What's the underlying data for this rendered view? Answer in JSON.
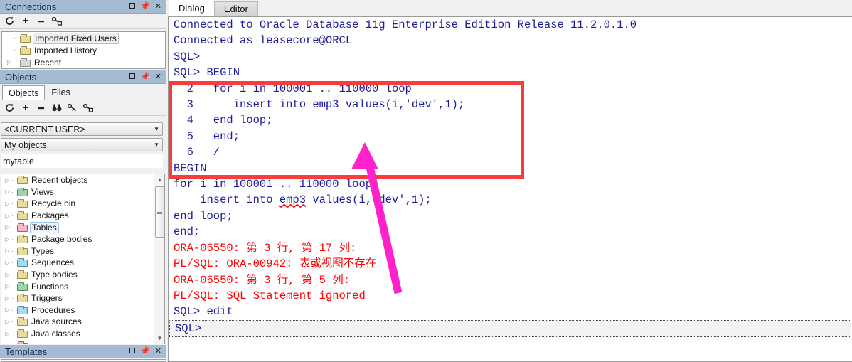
{
  "connections_panel": {
    "title": "Connections",
    "window_buttons": [
      "maximize",
      "pin",
      "close"
    ],
    "toolbar_icons": [
      "refresh-icon",
      "plus-icon",
      "minus-icon",
      "key-lock-icon"
    ],
    "tree": [
      {
        "label": "Imported Fixed Users",
        "icon": "folder-icon",
        "color": "yellow",
        "expander": false,
        "selected": true
      },
      {
        "label": "Imported History",
        "icon": "folder-icon",
        "color": "yellow",
        "expander": false,
        "selected": false
      },
      {
        "label": "Recent",
        "icon": "folder-icon",
        "color": "gray",
        "expander": true,
        "selected": false
      }
    ]
  },
  "objects_panel": {
    "title": "Objects",
    "window_buttons": [
      "maximize",
      "pin",
      "close"
    ],
    "tabs": [
      {
        "label": "Objects",
        "active": true
      },
      {
        "label": "Files",
        "active": false
      }
    ],
    "toolbar_icons": [
      "refresh-icon",
      "plus-icon",
      "minus-icon",
      "binoculars-icon",
      "key-icon",
      "key-lock-icon"
    ],
    "user_select": {
      "value": "<CURRENT USER>"
    },
    "scope_select": {
      "value": "My objects"
    },
    "filter_field": {
      "value": "mytable",
      "placeholder": ""
    },
    "tree": [
      {
        "label": "Recent objects",
        "color": "yellow",
        "selected": false
      },
      {
        "label": "Views",
        "color": "green",
        "selected": false
      },
      {
        "label": "Recycle bin",
        "color": "yellow",
        "selected": false
      },
      {
        "label": "Packages",
        "color": "yellow",
        "selected": false
      },
      {
        "label": "Tables",
        "color": "pink",
        "selected": true
      },
      {
        "label": "Package bodies",
        "color": "yellow",
        "selected": false
      },
      {
        "label": "Types",
        "color": "yellow",
        "selected": false
      },
      {
        "label": "Sequences",
        "color": "cyan",
        "selected": false
      },
      {
        "label": "Type bodies",
        "color": "yellow",
        "selected": false
      },
      {
        "label": "Functions",
        "color": "green",
        "selected": false
      },
      {
        "label": "Triggers",
        "color": "yellow",
        "selected": false
      },
      {
        "label": "Procedures",
        "color": "cyan",
        "selected": false
      },
      {
        "label": "Java sources",
        "color": "yellow",
        "selected": false
      },
      {
        "label": "Java classes",
        "color": "yellow",
        "selected": false
      },
      {
        "label": "..",
        "color": "pink",
        "selected": false
      }
    ]
  },
  "templates_panel": {
    "title": "Templates",
    "window_buttons": [
      "maximize",
      "pin",
      "close"
    ]
  },
  "main": {
    "tabs": [
      {
        "label": "Dialog",
        "active": true
      },
      {
        "label": "Editor",
        "active": false
      }
    ],
    "console_lines": [
      {
        "text": "Connected to Oracle Database 11g Enterprise Edition Release 11.2.0.1.0",
        "kind": "normal"
      },
      {
        "text": "Connected as leasecore@ORCL",
        "kind": "normal"
      },
      {
        "text": "",
        "kind": "blank"
      },
      {
        "text": "SQL>",
        "kind": "normal"
      },
      {
        "text": "SQL> BEGIN",
        "kind": "normal"
      },
      {
        "text": "  2   for i in 100001 .. 110000 loop",
        "kind": "normal"
      },
      {
        "text": "  3      insert into emp3 values(i,'dev',1);",
        "kind": "normal"
      },
      {
        "text": "  4   end loop;",
        "kind": "normal"
      },
      {
        "text": "  5   end;",
        "kind": "normal"
      },
      {
        "text": "  6   /",
        "kind": "normal"
      },
      {
        "text": "BEGIN",
        "kind": "normal"
      },
      {
        "text": "for i in 100001 .. 110000 loop",
        "kind": "normal"
      },
      {
        "text": "    insert into emp3 values(i,'dev',1);",
        "kind": "normal",
        "squiggle": "emp3"
      },
      {
        "text": "end loop;",
        "kind": "normal"
      },
      {
        "text": "end;",
        "kind": "normal"
      },
      {
        "text": "ORA-06550: 第 3 行, 第 17 列:",
        "kind": "error"
      },
      {
        "text": "PL/SQL: ORA-00942: 表或视图不存在",
        "kind": "error"
      },
      {
        "text": "ORA-06550: 第 3 行, 第 5 列:",
        "kind": "error"
      },
      {
        "text": "PL/SQL: SQL Statement ignored",
        "kind": "error"
      },
      {
        "text": "",
        "kind": "blank"
      },
      {
        "text": "SQL> edit",
        "kind": "normal"
      },
      {
        "text": "SQL>",
        "kind": "normal",
        "focused": true
      }
    ]
  },
  "annotations": {
    "highlight_box": {
      "shape": "rectangle",
      "color": "#fa3c3c",
      "target": "sql-begin-block"
    },
    "arrow": {
      "shape": "arrow",
      "color": "#ff22cc",
      "points_to": "emp3"
    }
  },
  "colors": {
    "console_text": "#1d1d9c",
    "error_text": "#ff0000",
    "panel_title_bg": "#a3bcd3",
    "annotation_red": "#fa3c3c",
    "annotation_magenta": "#ff22cc"
  }
}
